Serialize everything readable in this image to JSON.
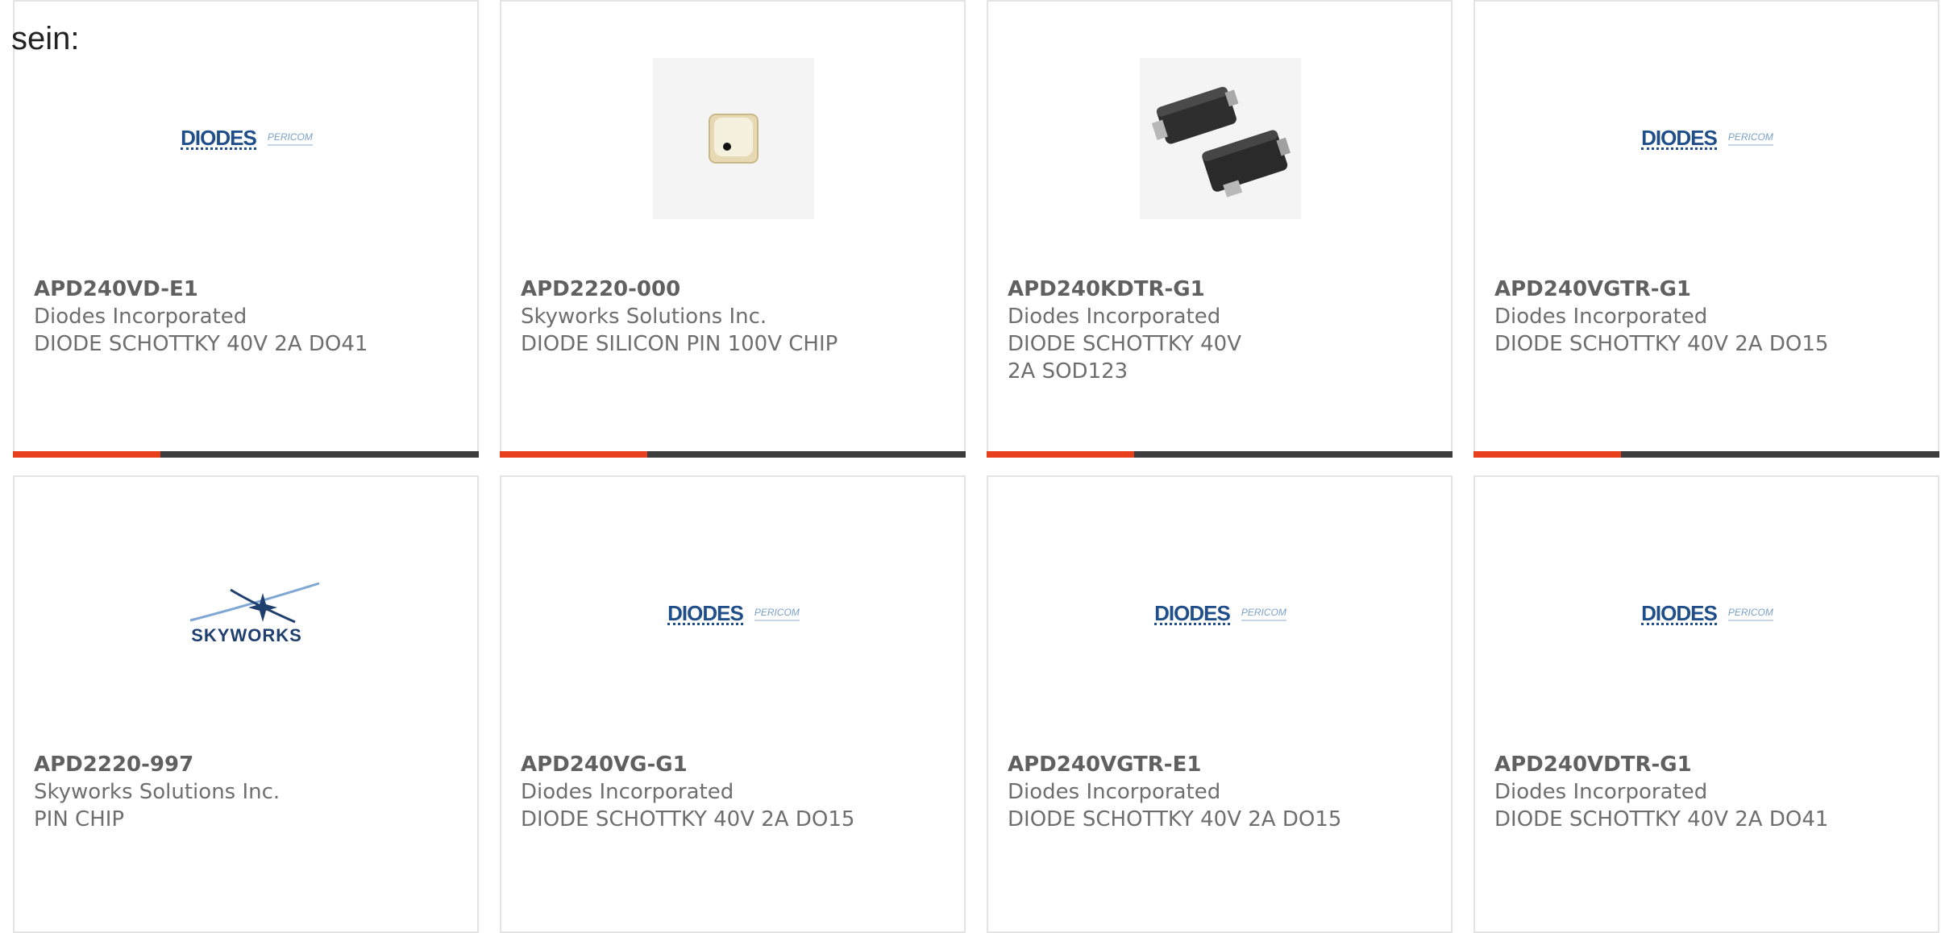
{
  "intro_text": "sein:",
  "logos": {
    "diodes": "DIODES",
    "pericom": "PERICOM",
    "skyworks": "SKYWORKS"
  },
  "colors": {
    "accent": "#e8401c",
    "bar": "#3d3d3d",
    "diodes_blue": "#1f4e8a"
  },
  "products": [
    {
      "part": "APD240VD-E1",
      "manufacturer": "Diodes Incorporated",
      "description": "DIODE SCHOTTKY 40V 2A DO41",
      "image": "diodes-logo"
    },
    {
      "part": "APD2220-000",
      "manufacturer": "Skyworks Solutions Inc.",
      "description": "DIODE SILICON PIN 100V CHIP",
      "image": "pin-chip-photo"
    },
    {
      "part": "APD240KDTR-G1",
      "manufacturer": "Diodes Incorporated",
      "description": "DIODE SCHOTTKY 40V 2A SOD123",
      "image": "sod123-photo"
    },
    {
      "part": "APD240VGTR-G1",
      "manufacturer": "Diodes Incorporated",
      "description": "DIODE SCHOTTKY 40V 2A DO15",
      "image": "diodes-logo"
    },
    {
      "part": "APD2220-997",
      "manufacturer": "Skyworks Solutions Inc.",
      "description": "PIN CHIP",
      "image": "skyworks-logo"
    },
    {
      "part": "APD240VG-G1",
      "manufacturer": "Diodes Incorporated",
      "description": "DIODE SCHOTTKY 40V 2A DO15",
      "image": "diodes-logo"
    },
    {
      "part": "APD240VGTR-E1",
      "manufacturer": "Diodes Incorporated",
      "description": "DIODE SCHOTTKY 40V 2A DO15",
      "image": "diodes-logo"
    },
    {
      "part": "APD240VDTR-G1",
      "manufacturer": "Diodes Incorporated",
      "description": "DIODE SCHOTTKY 40V 2A DO41",
      "image": "diodes-logo"
    }
  ]
}
